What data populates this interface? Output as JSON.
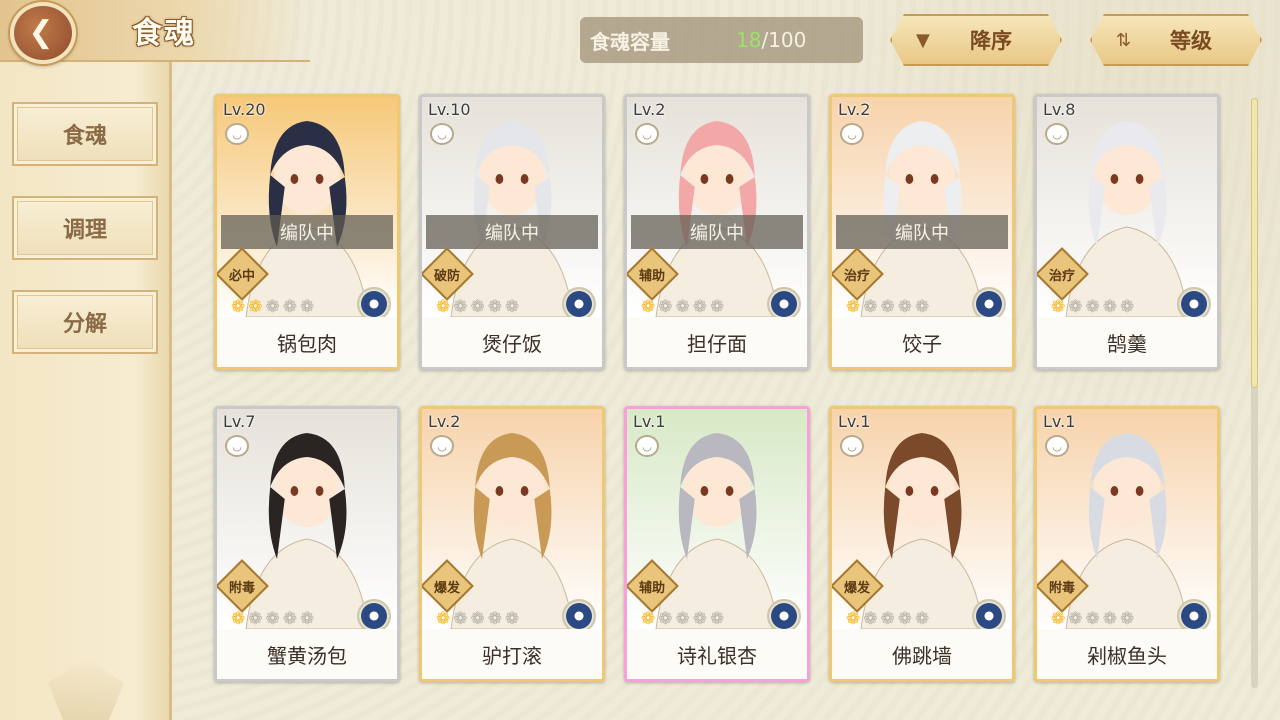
{
  "header": {
    "title": "食魂",
    "back_icon": "back-arrow-icon"
  },
  "sidebar": {
    "tabs": [
      {
        "label": "食魂",
        "active": true
      },
      {
        "label": "调理",
        "active": false
      },
      {
        "label": "分解",
        "active": false
      }
    ]
  },
  "capacity": {
    "label": "食魂容量",
    "current": "18",
    "max": "/100"
  },
  "sort": {
    "order_label": "降序",
    "order_icon": "triangle-down-icon",
    "level_label": "等级",
    "level_icon": "sort-arrows-icon"
  },
  "cards": [
    {
      "level": "Lv.20",
      "name": "锅包肉",
      "role": "必中",
      "team": "编队中",
      "stars_on": 2,
      "stars_total": 5,
      "frame": "gold",
      "tint": "#f6c879"
    },
    {
      "level": "Lv.10",
      "name": "煲仔饭",
      "role": "破防",
      "team": "编队中",
      "stars_on": 1,
      "stars_total": 5,
      "frame": "silver",
      "tint": "#e6e2da"
    },
    {
      "level": "Lv.2",
      "name": "担仔面",
      "role": "辅助",
      "team": "编队中",
      "stars_on": 1,
      "stars_total": 5,
      "frame": "silver",
      "tint": "#e6e2da"
    },
    {
      "level": "Lv.2",
      "name": "饺子",
      "role": "治疗",
      "team": "编队中",
      "stars_on": 1,
      "stars_total": 5,
      "frame": "gold",
      "tint": "#f7d3ab"
    },
    {
      "level": "Lv.8",
      "name": "鹄羹",
      "role": "治疗",
      "team": "",
      "stars_on": 1,
      "stars_total": 5,
      "frame": "silver",
      "tint": "#e6e2da"
    },
    {
      "level": "Lv.7",
      "name": "蟹黄汤包",
      "role": "附毒",
      "team": "",
      "stars_on": 1,
      "stars_total": 5,
      "frame": "silver",
      "tint": "#e6e2da"
    },
    {
      "level": "Lv.2",
      "name": "驴打滚",
      "role": "爆发",
      "team": "",
      "stars_on": 1,
      "stars_total": 5,
      "frame": "gold",
      "tint": "#f7d3ab"
    },
    {
      "level": "Lv.1",
      "name": "诗礼银杏",
      "role": "辅助",
      "team": "",
      "stars_on": 1,
      "stars_total": 5,
      "frame": "rainbow",
      "tint": "#d7e9c6"
    },
    {
      "level": "Lv.1",
      "name": "佛跳墙",
      "role": "爆发",
      "team": "",
      "stars_on": 1,
      "stars_total": 5,
      "frame": "gold",
      "tint": "#f7d3ab"
    },
    {
      "level": "Lv.1",
      "name": "剁椒鱼头",
      "role": "附毒",
      "team": "",
      "stars_on": 1,
      "stars_total": 5,
      "frame": "gold",
      "tint": "#f7d3ab"
    }
  ]
}
